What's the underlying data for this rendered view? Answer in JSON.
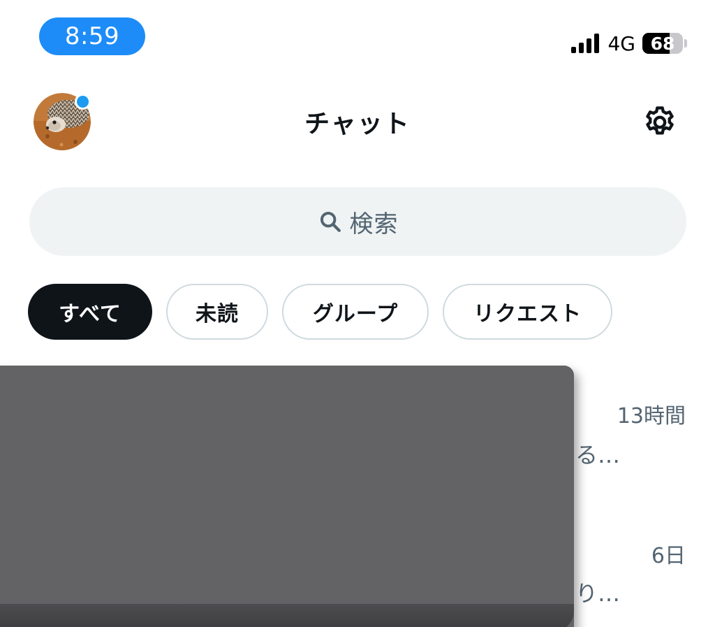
{
  "status_bar": {
    "time": "8:59",
    "network": "4G",
    "battery_level": "68",
    "battery_fraction": 0.68
  },
  "header": {
    "title": "チャット"
  },
  "search": {
    "placeholder": "検索"
  },
  "filters": [
    {
      "label": "すべて",
      "active": true
    },
    {
      "label": "未読",
      "active": false
    },
    {
      "label": "グループ",
      "active": false
    },
    {
      "label": "リクエスト",
      "active": false
    }
  ],
  "conversations": [
    {
      "time": "13時間",
      "snippet": "る…"
    },
    {
      "time": "6日",
      "snippet": "なり…"
    }
  ],
  "colors": {
    "accent": "#1d9bf0",
    "time_pill": "#1d8cf8",
    "text_primary": "#0f1419",
    "text_secondary": "#536471",
    "search_bg": "#eff3f4",
    "chip_border": "#cfd9de",
    "redaction": "#636366"
  },
  "icons": {
    "settings": "gear-icon",
    "search": "search-icon"
  }
}
